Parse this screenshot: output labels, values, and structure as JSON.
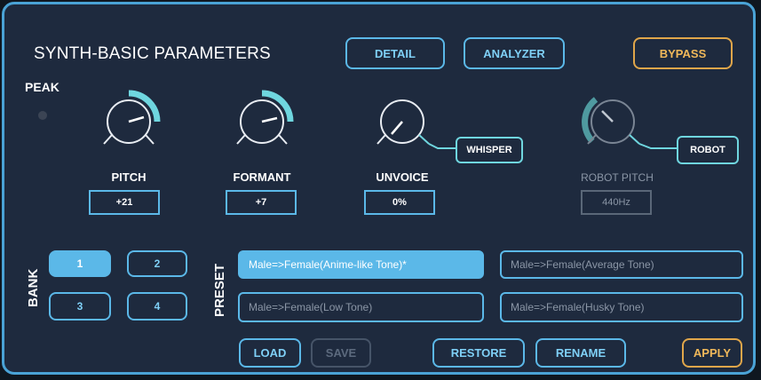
{
  "title": "SYNTH-BASIC PARAMETERS",
  "top_buttons": {
    "detail": "DETAIL",
    "analyzer": "ANALYZER",
    "bypass": "BYPASS"
  },
  "peak": {
    "label": "PEAK"
  },
  "knobs": {
    "pitch": {
      "label": "PITCH",
      "value": "+21"
    },
    "formant": {
      "label": "FORMANT",
      "value": "+7"
    },
    "unvoice": {
      "label": "UNVOICE",
      "value": "0%",
      "tag": "WHISPER"
    },
    "robot_pitch": {
      "label": "ROBOT PITCH",
      "value": "440Hz",
      "tag": "ROBOT"
    }
  },
  "bank": {
    "label": "BANK",
    "buttons": [
      "1",
      "2",
      "3",
      "4"
    ],
    "selected": "1"
  },
  "preset": {
    "label": "PRESET",
    "items": [
      "Male=>Female(Anime-like Tone)*",
      "Male=>Female(Average Tone)",
      "Male=>Female(Low Tone)",
      "Male=>Female(Husky Tone)"
    ],
    "selected": "Male=>Female(Anime-like Tone)*"
  },
  "bottom_buttons": {
    "load": "LOAD",
    "save": "SAVE",
    "restore": "RESTORE",
    "rename": "RENAME",
    "apply": "APPLY"
  },
  "colors": {
    "accent": "#5bb8e8",
    "cyan_arc": "#6fd6df",
    "orange": "#e0a64a",
    "panel": "#1e2a3e"
  }
}
